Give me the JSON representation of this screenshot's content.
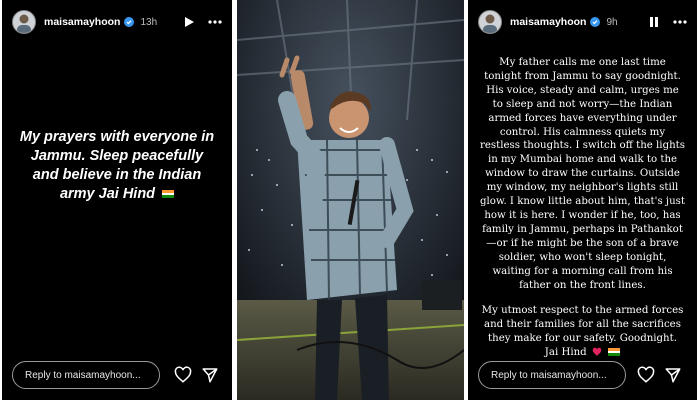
{
  "story_left": {
    "username": "maisamayhoon",
    "time": "13h",
    "message": "My prayers with everyone in Jammu. Sleep peacefully and believe in the Indian army Jai Hind",
    "reply_placeholder": "Reply to maisamayhoon...",
    "icons": [
      "avatar",
      "verified-badge-icon",
      "play-icon",
      "more-icon",
      "heart-icon",
      "send-icon",
      "india-flag-icon"
    ]
  },
  "story_right": {
    "username": "maisamayhoon",
    "time": "9h",
    "paragraph1": "My father calls me one last time tonight from Jammu to say goodnight. His voice, steady and calm, urges me to sleep and not worry—the Indian armed forces have everything under control. His calmness quiets my restless thoughts. I switch off the lights in my Mumbai home and walk to the window to draw the curtains. Outside my window, my neighbor's lights still glow. I know little about him, that's just how it is here. I wonder if he, too, has family in Jammu, perhaps in Pathankot—or if he might be the son of a brave soldier, who won't sleep tonight, waiting for a morning call from his father on the front lines.",
    "paragraph2": "My utmost respect to the armed forces and their families for all the sacrifices they make for our safety. Goodnight. Jai Hind",
    "reply_placeholder": "Reply to maisamayhoon...",
    "icons": [
      "avatar",
      "verified-badge-icon",
      "pause-icon",
      "more-icon",
      "heart-icon",
      "send-icon",
      "red-heart-icon",
      "india-flag-icon"
    ]
  },
  "colors": {
    "story_bg": "#000000",
    "text": "#ffffff",
    "muted": "#bfbfbf",
    "verified": "#3897f0",
    "flag_saffron": "#ff9933",
    "flag_green": "#138808",
    "heart_red": "#e0245e"
  }
}
